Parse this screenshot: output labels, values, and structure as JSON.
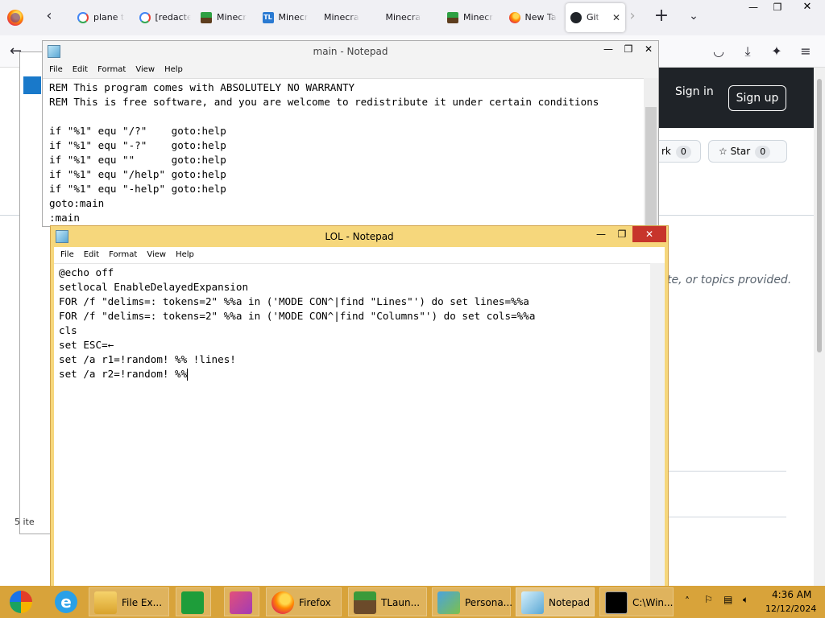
{
  "browser": {
    "tabs": [
      {
        "title": "plane t",
        "icon": "google-icon"
      },
      {
        "title": "[redacted]",
        "icon": "google-icon"
      },
      {
        "title": "Minecr",
        "icon": "minecraft-icon"
      },
      {
        "title": "Minecr",
        "icon": "tlauncher-icon"
      },
      {
        "title": "Minecraft C",
        "icon": ""
      },
      {
        "title": "Minecraft C",
        "icon": ""
      },
      {
        "title": "Minecr",
        "icon": "minecraft-icon"
      },
      {
        "title": "New Ta",
        "icon": "firefox-icon"
      },
      {
        "title": "Git",
        "icon": "github-icon",
        "active": true
      }
    ],
    "tab_close": "✕",
    "new_tab": "+",
    "window_controls": {
      "minimize": "—",
      "maximize": "❐",
      "close": "✕"
    }
  },
  "github": {
    "sign_in": "Sign in",
    "sign_up": "Sign up",
    "fork_label": "rk",
    "fork_count": "0",
    "star_label": "Star",
    "star_count": "0",
    "about_text": "te, or topics provided."
  },
  "explorer": {
    "items_count": "5 ite"
  },
  "notepad_main": {
    "title": "main - Notepad",
    "menu": [
      "File",
      "Edit",
      "Format",
      "View",
      "Help"
    ],
    "lines": [
      "REM This program comes with ABSOLUTELY NO WARRANTY",
      "REM This is free software, and you are welcome to redistribute it under certain conditions",
      "",
      "if \"%1\" equ \"/?\"    goto:help",
      "if \"%1\" equ \"-?\"    goto:help",
      "if \"%1\" equ \"\"      goto:help",
      "if \"%1\" equ \"/help\" goto:help",
      "if \"%1\" equ \"-help\" goto:help",
      "goto:main",
      ":main"
    ]
  },
  "notepad_lol": {
    "title": "LOL - Notepad",
    "menu": [
      "File",
      "Edit",
      "Format",
      "View",
      "Help"
    ],
    "lines": [
      "@echo off",
      "setlocal EnableDelayedExpansion",
      "FOR /f \"delims=: tokens=2\" %%a in ('MODE CON^|find \"Lines\"') do set lines=%%a",
      "FOR /f \"delims=: tokens=2\" %%a in ('MODE CON^|find \"Columns\"') do set cols=%%a",
      "cls",
      "set ESC=←",
      "set /a r1=!random! %% !lines!",
      "set /a r2=!random! %%"
    ]
  },
  "taskbar": {
    "apps": [
      {
        "label": "File Ex...",
        "icon": "folder-icon"
      },
      {
        "label": "",
        "icon": "store-icon"
      },
      {
        "label": "",
        "icon": "origami-icon"
      },
      {
        "label": "Firefox",
        "icon": "firefox-icon"
      },
      {
        "label": "TLaun...",
        "icon": "minecraft-icon"
      },
      {
        "label": "Persona...",
        "icon": "personalize-icon"
      },
      {
        "label": "Notepad",
        "icon": "notepad-icon",
        "active": true
      },
      {
        "label": "C:\\Win...",
        "icon": "cmd-icon"
      }
    ],
    "clock_time": "4:36 AM",
    "clock_date": "12/12/2024"
  }
}
